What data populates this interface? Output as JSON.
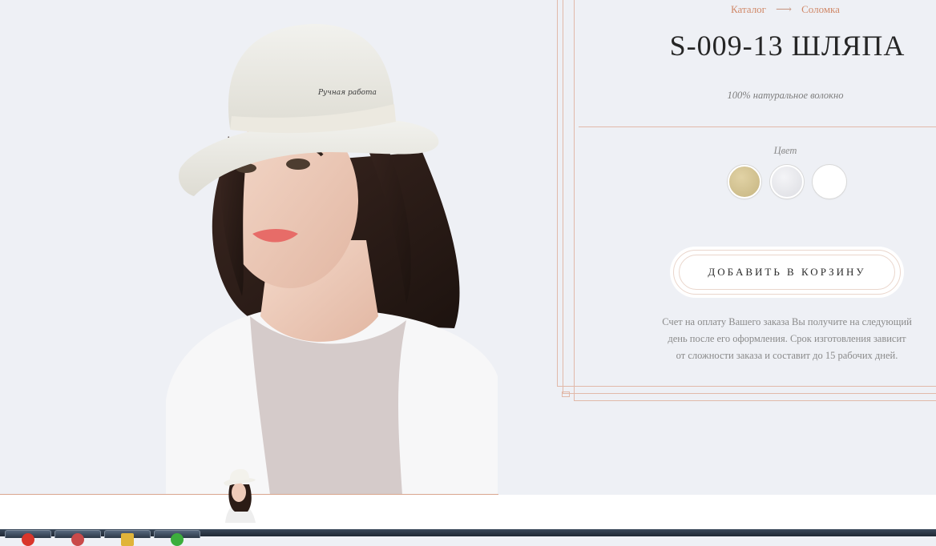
{
  "breadcrumb": {
    "catalog": "Каталог",
    "arrow": "⟶",
    "category": "Соломка"
  },
  "product": {
    "title": "S-009-13 ШЛЯПА",
    "material": "100% натуральное волокно"
  },
  "colors": {
    "label": "Цвет",
    "options": [
      {
        "name": "beige",
        "color": "#d3c493"
      },
      {
        "name": "light-grey",
        "color": "#e8e9ed"
      },
      {
        "name": "white",
        "color": "#ffffff"
      }
    ]
  },
  "cart": {
    "button_label": "ДОБАВИТЬ В КОРЗИНУ"
  },
  "note": {
    "line1": "Счет на оплату Вашего заказа Вы получите на следующий",
    "line2": "день после его оформления. Срок изготовления зависит",
    "line3": "от сложности заказа и составит до 15 рабочих дней."
  },
  "theme": {
    "background": "#eef0f5",
    "accent": "#d08868",
    "frame": "#e1b9a9"
  },
  "photo": {
    "hatband_text": "Ручная работа"
  },
  "taskbar": {
    "items": [
      "red-app-icon",
      "app-icon",
      "folder-icon",
      "green-app-icon"
    ]
  }
}
